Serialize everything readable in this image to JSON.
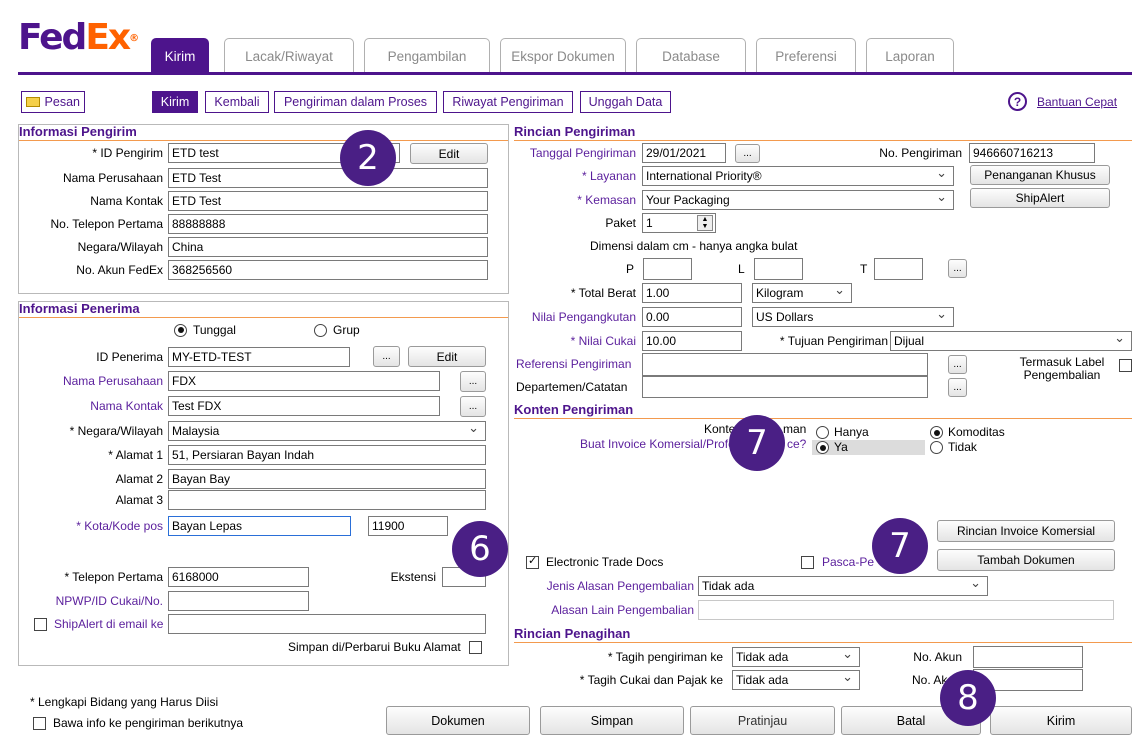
{
  "brand": {
    "fed": "Fed",
    "ex": "Ex",
    "dot": "®"
  },
  "tabs": [
    "Kirim",
    "Lacak/Riwayat",
    "Pengambilan",
    "Ekspor Dokumen",
    "Database",
    "Preferensi",
    "Laporan"
  ],
  "actions": {
    "pesan": "Pesan",
    "kirim": "Kirim",
    "kembali": "Kembali",
    "proses": "Pengiriman dalam Proses",
    "riwayat": "Riwayat Pengiriman",
    "unggah": "Unggah Data"
  },
  "help": {
    "icon": "?",
    "label": "Bantuan Cepat"
  },
  "sender": {
    "title": "Informasi Pengirim",
    "id_label": "* ID Pengirim",
    "id_value": "ETD test",
    "edit": "Edit",
    "company_label": "Nama Perusahaan",
    "company_value": "ETD Test",
    "contact_label": "Nama Kontak",
    "contact_value": "ETD Test",
    "phone_label": "No. Telepon Pertama",
    "phone_value": "88888888",
    "country_label": "Negara/Wilayah",
    "country_value": "China",
    "account_label": "No. Akun FedEx",
    "account_value": "368256560"
  },
  "recipient": {
    "title": "Informasi Penerima",
    "single": "Tunggal",
    "group": "Grup",
    "id_label": "ID Penerima",
    "id_value": "MY-ETD-TEST",
    "edit": "Edit",
    "dots": "...",
    "company_label": "Nama Perusahaan",
    "company_value": "FDX",
    "contact_label": "Nama Kontak",
    "contact_value": "Test FDX",
    "country_label": "* Negara/Wilayah",
    "country_value": "Malaysia",
    "addr1_label": "* Alamat 1",
    "addr1_value": "51, Persiaran Bayan Indah",
    "addr2_label": "Alamat 2",
    "addr2_value": "Bayan Bay",
    "addr3_label": "Alamat 3",
    "addr3_value": "",
    "city_label": "* Kota/Kode pos",
    "city_value": "Bayan Lepas",
    "postcode_value": "11900",
    "phone_label": "* Telepon Pertama",
    "phone_value": "6168000",
    "ext_label": "Ekstensi",
    "npwp_label": "NPWP/ID Cukai/No.",
    "shipalert_label": "ShipAlert di email ke",
    "save_label": "Simpan di/Perbarui Buku Alamat"
  },
  "shipment": {
    "title": "Rincian Pengiriman",
    "date_label": "Tanggal Pengiriman",
    "date_value": "29/01/2021",
    "dots": "...",
    "no_label": "No. Pengiriman",
    "no_value": "946660716213",
    "service_label": "* Layanan",
    "service_value": "International Priority®",
    "special_btn": "Penanganan Khusus",
    "package_label": "* Kemasan",
    "package_value": "Your Packaging",
    "shipalert_btn": "ShipAlert",
    "paket_label": "Paket",
    "paket_value": "1",
    "dim_note": "Dimensi dalam cm - hanya angka bulat",
    "p_label": "P",
    "l_label": "L",
    "t_label": "T",
    "weight_label": "* Total Berat",
    "weight_value": "1.00",
    "weight_unit": "Kilogram",
    "carriage_label": "Nilai Pengangkutan",
    "carriage_value": "0.00",
    "currency": "US Dollars",
    "customs_label": "* Nilai Cukai",
    "customs_value": "10.00",
    "purpose_label": "* Tujuan Pengiriman",
    "purpose_value": "Dijual",
    "ref_label": "Referensi Pengiriman",
    "dept_label": "Departemen/Catatan",
    "return_label": "Termasuk Label Pengembalian"
  },
  "contents": {
    "title": "Konten Pengiriman",
    "q1_left": "Konten",
    "q1_right": "man",
    "q2_left": "Buat Invoice Komersial/Profo",
    "q2_right": "ce?",
    "hanya": "Hanya",
    "komoditas": "Komoditas",
    "ya": "Ya",
    "tidak": "Tidak",
    "invoice_btn": "Rincian Invoice Komersial",
    "add_doc_btn": "Tambah Dokumen",
    "etd_label": "Electronic Trade Docs",
    "pasca_label": "Pasca-Pe",
    "return_reason_label": "Jenis Alasan Pengembalian",
    "return_reason_value": "Tidak ada",
    "other_reason_label": "Alasan Lain Pengembalian"
  },
  "billing": {
    "title": "Rincian Penagihan",
    "bill_label": "* Tagih pengiriman ke",
    "bill_value": "Tidak ada",
    "acct_label": "No. Akun",
    "duty_label": "* Tagih Cukai dan Pajak ke",
    "duty_value": "Tidak ada",
    "acct2_label": "No. Ak"
  },
  "footer": {
    "required_note": "* Lengkapi Bidang yang Harus Diisi",
    "carry_label": "Bawa info ke pengiriman berikutnya",
    "dokumen": "Dokumen",
    "simpan": "Simpan",
    "pratinjau": "Pratinjau",
    "batal": "Batal",
    "kirim": "Kirim"
  },
  "markers": [
    "2",
    "6",
    "7",
    "7",
    "8"
  ],
  "colors": {
    "fedex_purple": "#4d148c",
    "fedex_orange": "#ff6200",
    "marker": "#4a1f85",
    "section_line": "#f39a4e"
  }
}
